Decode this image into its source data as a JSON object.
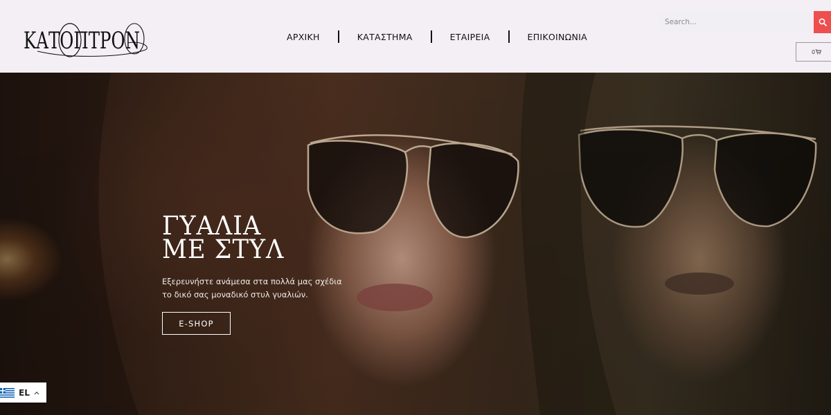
{
  "brand": {
    "logo_text": "ΚΑΤΟΠΤΡΟΝ"
  },
  "nav": {
    "items": [
      {
        "label": "ΑΡΧΙΚΗ"
      },
      {
        "label": "ΚΑΤΑΣΤΗΜΑ"
      },
      {
        "label": "ΕΤΑΙΡΕΙΑ"
      },
      {
        "label": "ΕΠΙΚΟΙΝΩΝΙΑ"
      }
    ]
  },
  "search": {
    "placeholder": "Search...",
    "icon": "search-icon"
  },
  "cart": {
    "count": "0",
    "icon": "cart-icon"
  },
  "hero": {
    "title_line1": "ΓΥΑΛΙΑ",
    "title_line2": "ΜΕ ΣΤΥΛ",
    "description": "Εξερευνήστε ανάμεσα στα πολλά μας σχέδια το δικό σας μοναδικό στυλ γυαλιών.",
    "cta_label": "E-SHOP",
    "image": "two women wearing aviator sunglasses"
  },
  "language": {
    "code": "EL",
    "flag": "greek-flag-icon",
    "chevron": "chevron-up-icon"
  },
  "colors": {
    "accent": "#ee4e4e",
    "header_bg": "#f3eff4"
  }
}
